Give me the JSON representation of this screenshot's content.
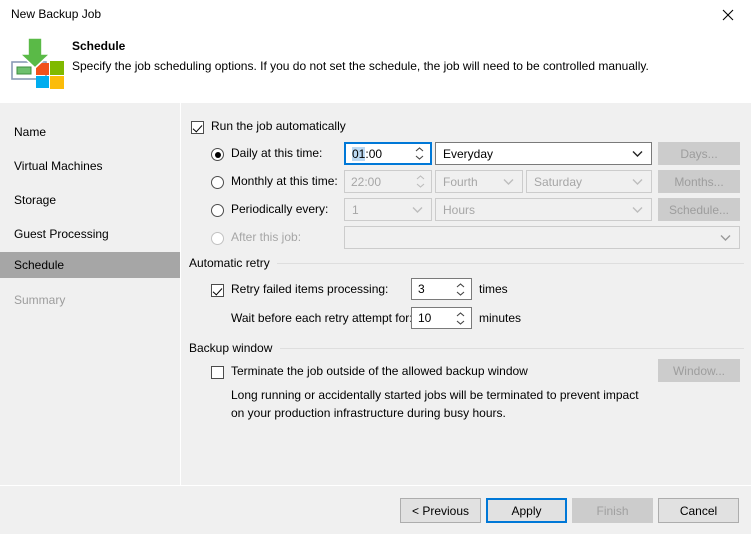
{
  "window": {
    "title": "New Backup Job",
    "close_label": "Close"
  },
  "header": {
    "title": "Schedule",
    "description": "Specify the job scheduling options. If you do not set the schedule, the job will need to be controlled manually."
  },
  "sidebar": {
    "items": [
      {
        "label": "Name",
        "state": "normal"
      },
      {
        "label": "Virtual Machines",
        "state": "normal"
      },
      {
        "label": "Storage",
        "state": "normal"
      },
      {
        "label": "Guest Processing",
        "state": "normal"
      },
      {
        "label": "Schedule",
        "state": "selected"
      },
      {
        "label": "Summary",
        "state": "disabled"
      }
    ]
  },
  "schedule": {
    "run_automatically": {
      "label": "Run the job automatically",
      "checked": true
    },
    "daily": {
      "label": "Daily at this time:",
      "selected": true,
      "time_value": "01:00",
      "time_selected_part": "01",
      "time_rest": ":00",
      "mode_value": "Everyday",
      "button_label": "Days..."
    },
    "monthly": {
      "label": "Monthly at this time:",
      "selected": false,
      "time_value": "22:00",
      "week_value": "Fourth",
      "day_value": "Saturday",
      "button_label": "Months..."
    },
    "periodically": {
      "label": "Periodically every:",
      "selected": false,
      "interval_value": "1",
      "unit_value": "Hours",
      "button_label": "Schedule..."
    },
    "after_job": {
      "label": "After this job:",
      "selected": false,
      "value": ""
    }
  },
  "automatic_retry": {
    "group_label": "Automatic retry",
    "retry_checkbox": {
      "label": "Retry failed items processing:",
      "checked": true
    },
    "retry_times_value": "3",
    "retry_times_suffix": "times",
    "wait_label": "Wait before each retry attempt for:",
    "wait_value": "10",
    "wait_suffix": "minutes"
  },
  "backup_window": {
    "group_label": "Backup window",
    "terminate_checkbox": {
      "label": "Terminate the job outside of the allowed backup window",
      "checked": false
    },
    "description_line1": "Long running or accidentally started jobs will be terminated to prevent impact",
    "description_line2": "on your production infrastructure during busy hours.",
    "window_button_label": "Window..."
  },
  "footer": {
    "previous_label": "< Previous",
    "apply_label": "Apply",
    "finish_label": "Finish",
    "cancel_label": "Cancel"
  },
  "colors": {
    "accent": "#0078d7",
    "selection": "#bcd9f2",
    "nav_selected": "#a6a6a6",
    "panel": "#f0f0f0",
    "disabled_text": "#a6a6a6"
  }
}
